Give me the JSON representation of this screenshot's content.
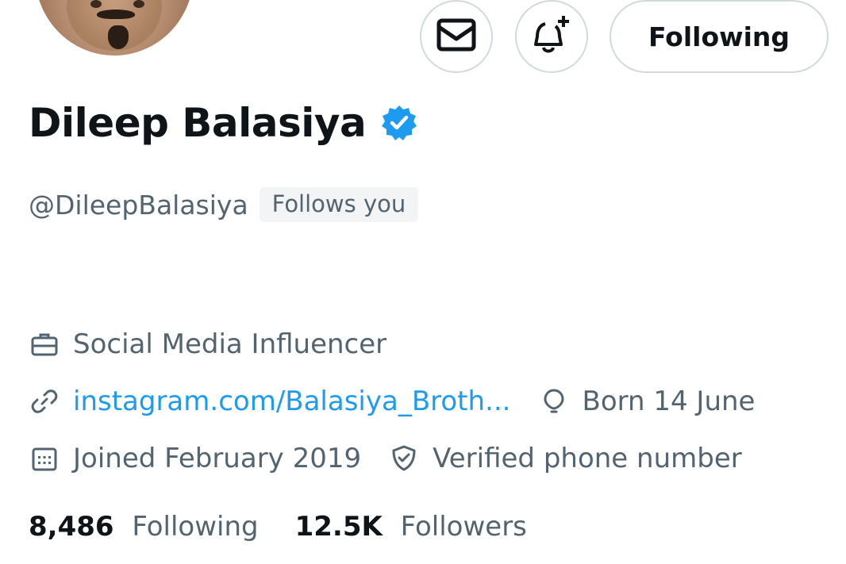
{
  "profile": {
    "name": "Dileep Balasiya",
    "handle": "@DileepBalasiya",
    "follows_you": "Follows you"
  },
  "actions": {
    "message_icon": "envelope-icon",
    "notify_icon": "bell-plus-icon",
    "following_label": "Following"
  },
  "meta": {
    "category": "Social Media Influencer",
    "website": "instagram.com/Balasiya_Broth...",
    "birthday": "Born 14 June",
    "joined": "Joined February 2019",
    "verified_phone": "Verified phone number"
  },
  "stats": {
    "following_count": "8,486",
    "following_label": "Following",
    "followers_count": "12.5K",
    "followers_label": "Followers"
  },
  "colors": {
    "accent": "#1d9bf0",
    "secondary_text": "#536471",
    "primary_text": "#0f1419",
    "border": "#cfd9de"
  }
}
